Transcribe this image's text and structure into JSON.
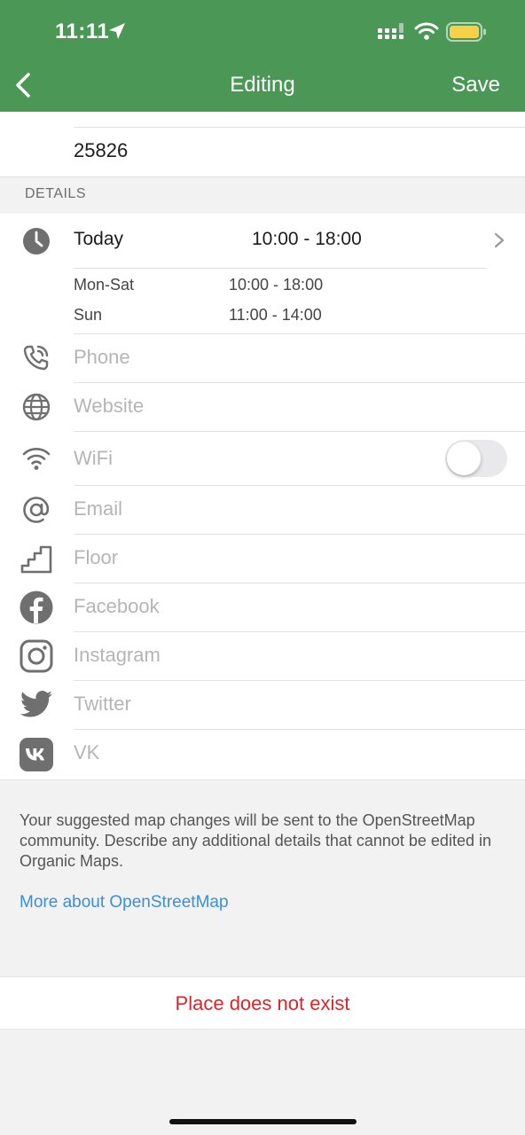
{
  "status_bar": {
    "time": "11:11"
  },
  "nav": {
    "title": "Editing",
    "save_label": "Save"
  },
  "top_field": {
    "value": "25826"
  },
  "section": {
    "title": "DETAILS"
  },
  "hours": {
    "today_label": "Today",
    "today_time": "10:00 - 18:00",
    "schedule": [
      {
        "days": "Mon-Sat",
        "time": "10:00 - 18:00"
      },
      {
        "days": "Sun",
        "time": "11:00 - 14:00"
      }
    ]
  },
  "fields": [
    {
      "icon": "phone-icon",
      "placeholder": "Phone"
    },
    {
      "icon": "globe-icon",
      "placeholder": "Website"
    },
    {
      "icon": "wifi-icon",
      "placeholder": "WiFi",
      "toggle_on": false
    },
    {
      "icon": "at-icon",
      "placeholder": "Email"
    },
    {
      "icon": "stairs-icon",
      "placeholder": "Floor"
    },
    {
      "icon": "facebook-icon",
      "placeholder": "Facebook"
    },
    {
      "icon": "instagram-icon",
      "placeholder": "Instagram"
    },
    {
      "icon": "twitter-icon",
      "placeholder": "Twitter"
    },
    {
      "icon": "vk-icon",
      "placeholder": "VK"
    }
  ],
  "footer": {
    "note": "Your suggested map changes will be sent to the OpenStreetMap community. Describe any additional details that cannot be edited in Organic Maps.",
    "link": "More about OpenStreetMap",
    "danger": "Place does not exist"
  },
  "colors": {
    "header": "#4b9756",
    "link": "#3a8fd8",
    "danger": "#d9262c",
    "placeholder": "#b5b5b5",
    "battery": "#f7d14a"
  }
}
